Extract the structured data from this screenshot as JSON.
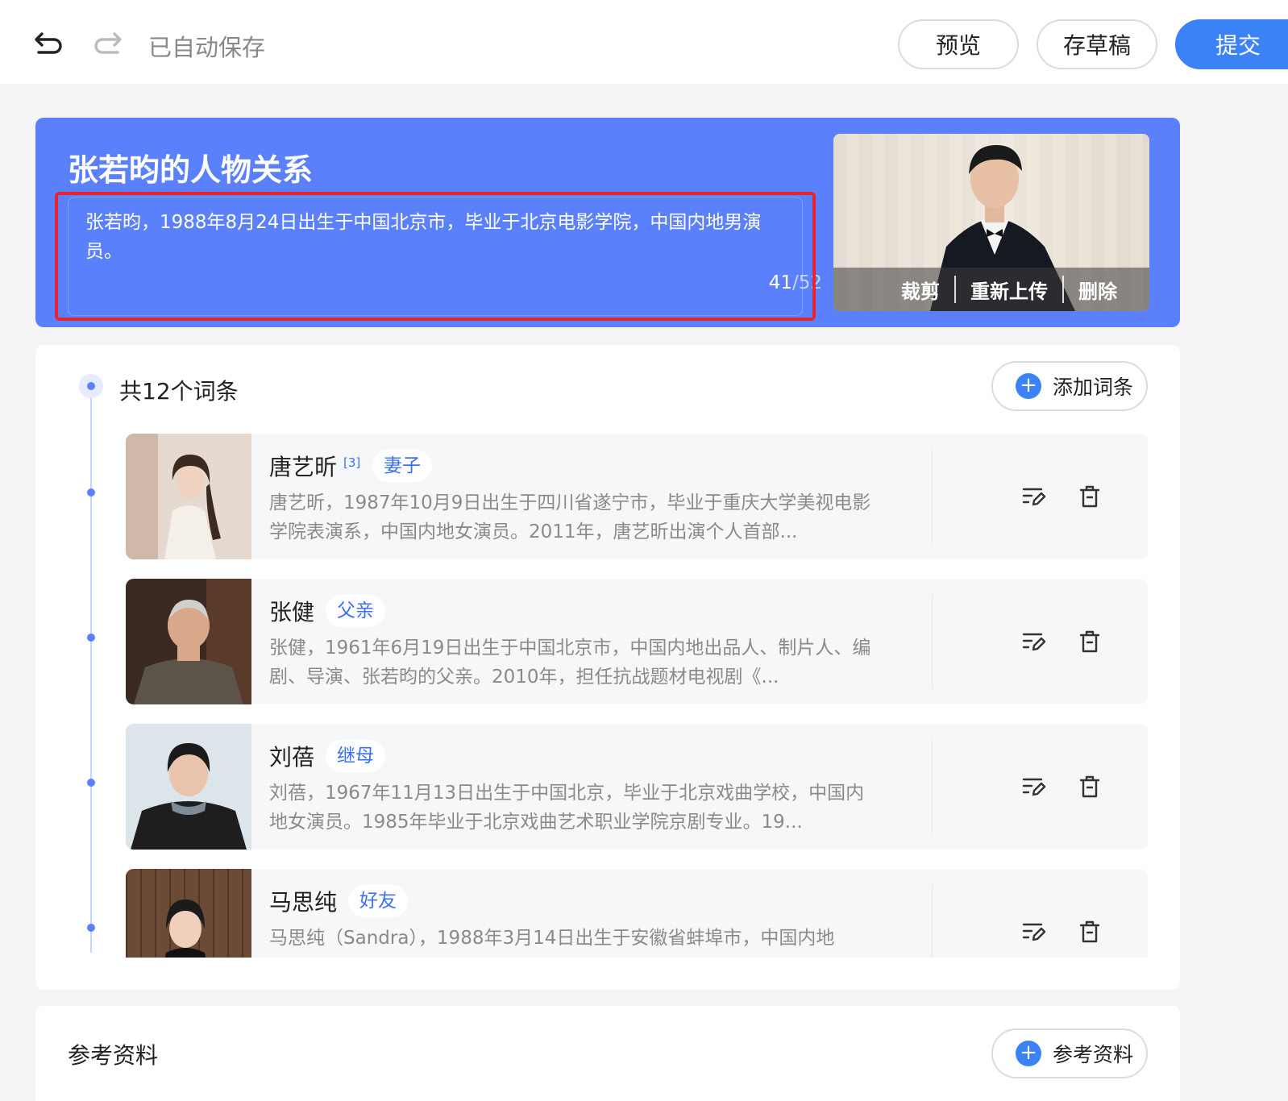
{
  "toolbar": {
    "autosave_label": "已自动保存",
    "preview_label": "预览",
    "draft_label": "存草稿",
    "submit_label": "提交",
    "undo_icon": "undo-icon",
    "redo_icon": "redo-icon"
  },
  "hero": {
    "title": "张若昀的人物关系",
    "description": "张若昀，1988年8月24日出生于中国北京市，毕业于北京电影学院，中国内地男演员。",
    "char_count": "41",
    "char_max": "/52",
    "photo_actions": {
      "crop": "裁剪",
      "reupload": "重新上传",
      "delete": "删除"
    },
    "background_color": "#5b80fc",
    "highlight_color": "#e9232d"
  },
  "entries": {
    "count_label": "共12个词条",
    "add_label": "添加词条",
    "items": [
      {
        "name": "唐艺昕",
        "citation": "[3]",
        "tag": "妻子",
        "description": "唐艺昕，1987年10月9日出生于四川省遂宁市，毕业于重庆大学美视电影学院表演系，中国内地女演员。2011年，唐艺昕出演个人首部..."
      },
      {
        "name": "张健",
        "citation": "",
        "tag": "父亲",
        "description": "张健，1961年6月19日出生于中国北京市，中国内地出品人、制片人、编剧、导演、张若昀的父亲。2010年，担任抗战题材电视剧《..."
      },
      {
        "name": "刘蓓",
        "citation": "",
        "tag": "继母",
        "description": "刘蓓，1967年11月13日出生于中国北京，毕业于北京戏曲学校，中国内地女演员。1985年毕业于北京戏曲艺术职业学院京剧专业。19..."
      },
      {
        "name": "马思纯",
        "citation": "",
        "tag": "好友",
        "description": "马思纯（Sandra），1988年3月14日出生于安徽省蚌埠市，中国内地"
      }
    ]
  },
  "references": {
    "title": "参考资料",
    "add_label": "参考资料"
  },
  "colors": {
    "accent": "#3b82f6",
    "tag_text": "#3b6ff5"
  }
}
